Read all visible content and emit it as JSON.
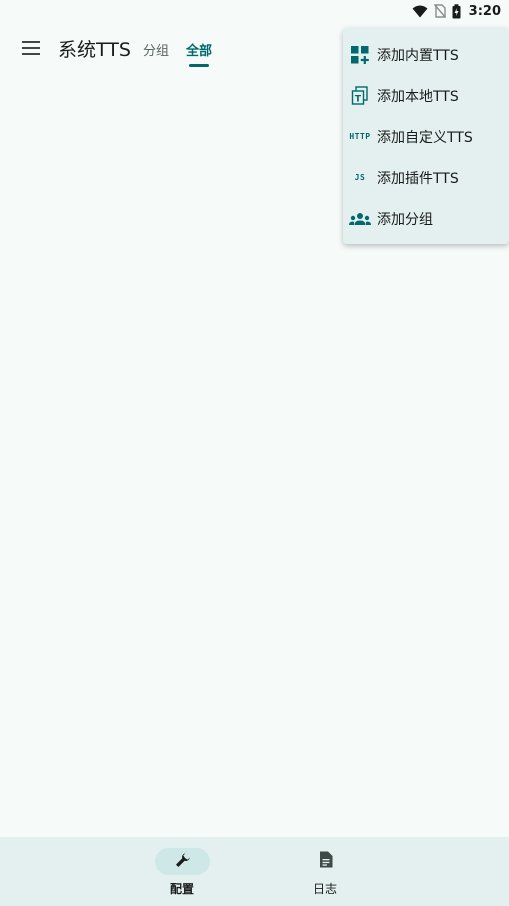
{
  "status_bar": {
    "time": "3:20",
    "icons": [
      "wifi-icon",
      "no-sim-icon",
      "battery-charging-icon"
    ]
  },
  "app_bar": {
    "menu_icon": "hamburger-menu-icon",
    "title": "系统TTS",
    "tabs": [
      {
        "label": "分组",
        "selected": false
      },
      {
        "label": "全部",
        "selected": true
      }
    ]
  },
  "dropdown_menu": {
    "items": [
      {
        "label": "添加内置TTS",
        "icon": "dashboard-add-icon"
      },
      {
        "label": "添加本地TTS",
        "icon": "file-copy-text-icon"
      },
      {
        "label": "添加自定义TTS",
        "icon": "http-icon",
        "icon_text": "HTTP"
      },
      {
        "label": "添加插件TTS",
        "icon": "javascript-icon",
        "icon_text": "JS"
      },
      {
        "label": "添加分组",
        "icon": "groups-icon"
      }
    ]
  },
  "bottom_nav": {
    "items": [
      {
        "label": "配置",
        "icon": "wrench-icon",
        "selected": true
      },
      {
        "label": "日志",
        "icon": "document-icon",
        "selected": false
      }
    ]
  },
  "colors": {
    "accent": "#00696b",
    "background": "#f6faf9",
    "surface": "#e4f0ef",
    "selected_pill": "#cde8e7"
  }
}
